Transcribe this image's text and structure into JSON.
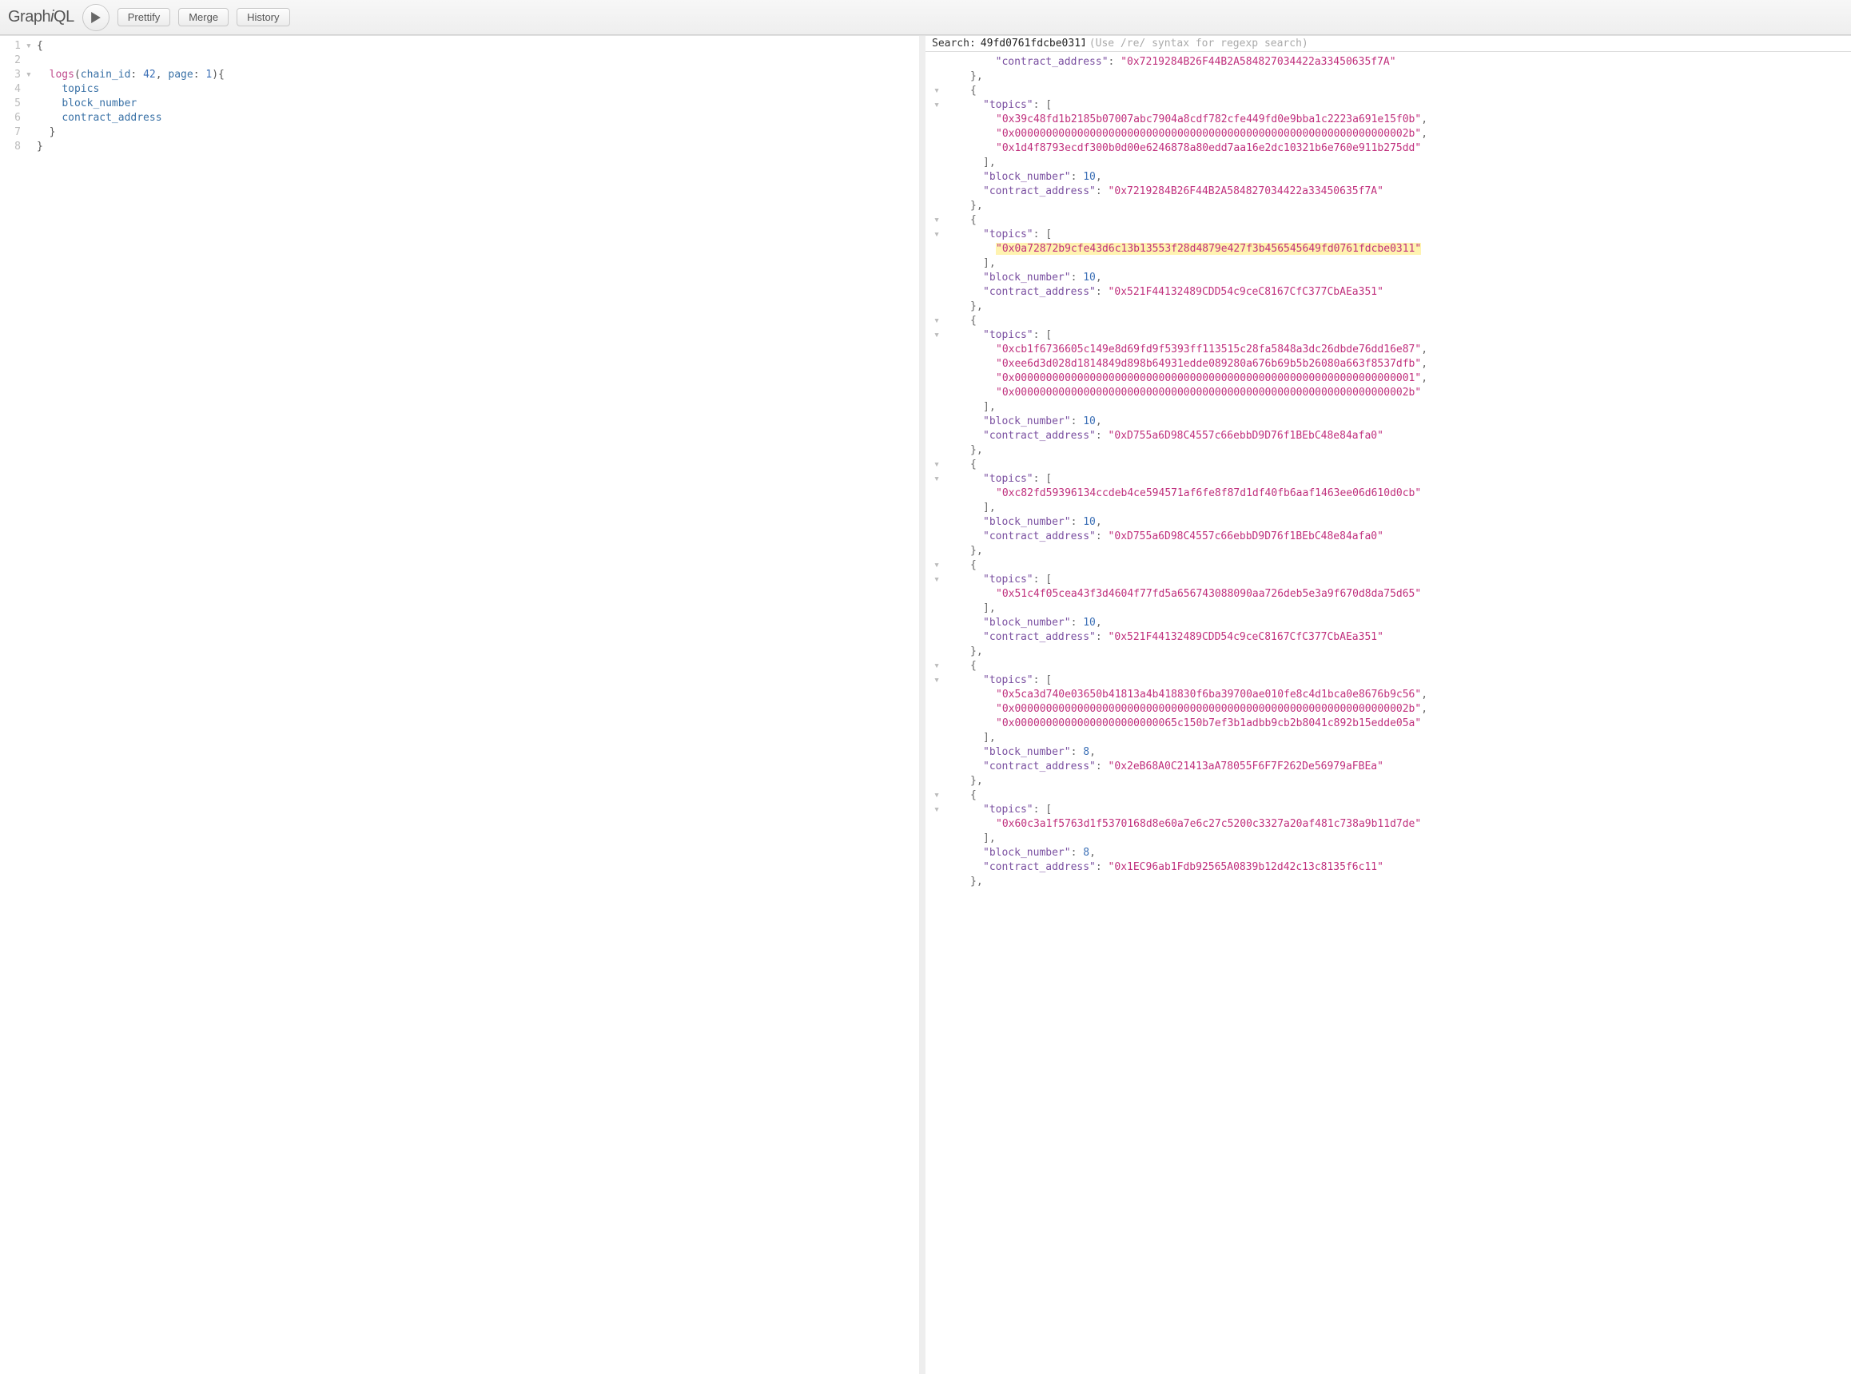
{
  "toolbar": {
    "logo_prefix": "Graph",
    "logo_em": "i",
    "logo_suffix": "QL",
    "prettify": "Prettify",
    "merge": "Merge",
    "history": "History"
  },
  "search": {
    "label": "Search:",
    "value": "49fd0761fdcbe0311",
    "hint": "(Use /re/ syntax for regexp search)"
  },
  "query": {
    "lines": [
      {
        "n": 1,
        "fold": "▾",
        "txt": "{"
      },
      {
        "n": 2,
        "fold": "",
        "txt": ""
      },
      {
        "n": 3,
        "fold": "▾",
        "txt": "  logs(chain_id: 42, page: 1){",
        "tokens": [
          [
            "  "
          ],
          [
            "kw",
            "logs"
          ],
          [
            "punc",
            "("
          ],
          [
            "arg",
            "chain_id"
          ],
          [
            "punc",
            ": "
          ],
          [
            "num",
            "42"
          ],
          [
            "punc",
            ", "
          ],
          [
            "arg",
            "page"
          ],
          [
            "punc",
            ": "
          ],
          [
            "num",
            "1"
          ],
          [
            "punc",
            "){"
          ]
        ]
      },
      {
        "n": 4,
        "fold": "",
        "txt": "    topics",
        "tokens": [
          [
            "    "
          ],
          [
            "field",
            "topics"
          ]
        ]
      },
      {
        "n": 5,
        "fold": "",
        "txt": "    block_number",
        "tokens": [
          [
            "    "
          ],
          [
            "field",
            "block_number"
          ]
        ]
      },
      {
        "n": 6,
        "fold": "",
        "txt": "    contract_address",
        "tokens": [
          [
            "    "
          ],
          [
            "field",
            "contract_address"
          ]
        ]
      },
      {
        "n": 7,
        "fold": "",
        "txt": "  }"
      },
      {
        "n": 8,
        "fold": "",
        "txt": "}"
      }
    ]
  },
  "result": {
    "truncated_header_key": "contract_address",
    "truncated_header_val": "0x7219284B26F44B2A584827034422a33450635f7A",
    "entries": [
      {
        "topics": [
          "0x39c48fd1b2185b07007abc7904a8cdf782cfe449fd0e9bba1c2223a691e15f0b",
          "0x000000000000000000000000000000000000000000000000000000000000002b",
          "0x1d4f8793ecdf300b0d00e6246878a80edd7aa16e2dc10321b6e760e911b275dd"
        ],
        "block_number": 10,
        "contract_address": "0x7219284B26F44B2A584827034422a33450635f7A"
      },
      {
        "topics": [
          "0x0a72872b9cfe43d6c13b13553f28d4879e427f3b456545649fd0761fdcbe0311"
        ],
        "block_number": 10,
        "contract_address": "0x521F44132489CDD54c9ceC8167CfC377CbAEa351",
        "highlight_topic_index": 0
      },
      {
        "topics": [
          "0xcb1f6736605c149e8d69fd9f5393ff113515c28fa5848a3dc26dbde76dd16e87",
          "0xee6d3d028d1814849d898b64931edde089280a676b69b5b26080a663f8537dfb",
          "0x0000000000000000000000000000000000000000000000000000000000000001",
          "0x000000000000000000000000000000000000000000000000000000000000002b"
        ],
        "block_number": 10,
        "contract_address": "0xD755a6D98C4557c66ebbD9D76f1BEbC48e84afa0"
      },
      {
        "topics": [
          "0xc82fd59396134ccdeb4ce594571af6fe8f87d1df40fb6aaf1463ee06d610d0cb"
        ],
        "block_number": 10,
        "contract_address": "0xD755a6D98C4557c66ebbD9D76f1BEbC48e84afa0"
      },
      {
        "topics": [
          "0x51c4f05cea43f3d4604f77fd5a656743088090aa726deb5e3a9f670d8da75d65"
        ],
        "block_number": 10,
        "contract_address": "0x521F44132489CDD54c9ceC8167CfC377CbAEa351"
      },
      {
        "topics": [
          "0x5ca3d740e03650b41813a4b418830f6ba39700ae010fe8c4d1bca0e8676b9c56",
          "0x000000000000000000000000000000000000000000000000000000000000002b",
          "0x00000000000000000000000065c150b7ef3b1adbb9cb2b8041c892b15edde05a"
        ],
        "block_number": 8,
        "contract_address": "0x2eB68A0C21413aA78055F6F7F262De56979aFBEa"
      },
      {
        "topics": [
          "0x60c3a1f5763d1f5370168d8e60a7e6c27c5200c3327a20af481c738a9b11d7de"
        ],
        "block_number": 8,
        "contract_address": "0x1EC96ab1Fdb92565A0839b12d42c13c8135f6c11"
      }
    ]
  }
}
